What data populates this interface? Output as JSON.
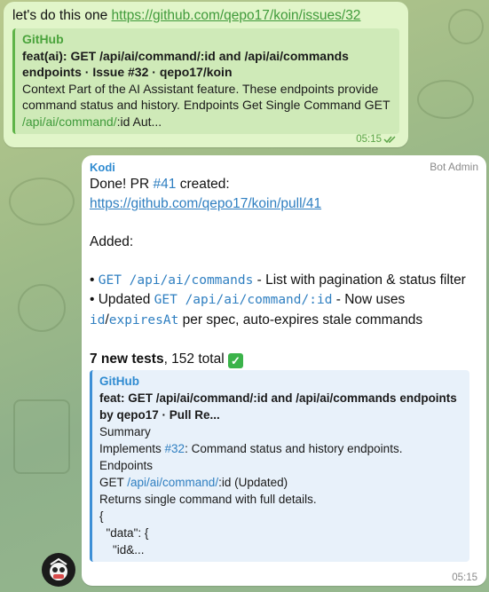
{
  "outgoing": {
    "text_prefix": "let's do this one ",
    "link": "https://github.com/qepo17/koin/issues/32",
    "preview": {
      "source": "GitHub",
      "title": "feat(ai): GET /api/ai/command/:id and /api/ai/commands endpoints · Issue #32 · qepo17/koin",
      "desc_a": "Context Part of the AI Assistant feature. These endpoints provide command status and history. Endpoints Get Single Command GET ",
      "desc_link": "/api/ai/command/",
      "desc_b": ":id Aut..."
    },
    "time": "05:15"
  },
  "incoming": {
    "sender": "Kodi",
    "role": "Bot Admin",
    "line1_a": "Done! PR ",
    "line1_pr": "#41",
    "line1_b": " created:",
    "pr_link": "https://github.com/qepo17/koin/pull/41",
    "added_label": "Added:",
    "bullet1": {
      "dot": "• ",
      "code": "GET /api/ai/commands",
      "rest": " - List with pagination & status filter"
    },
    "bullet2": {
      "prefix": "• Updated ",
      "code": "GET /api/ai/command/:id",
      "rest": " - Now uses ",
      "code2": "id",
      "slash": "/",
      "code3": "expiresAt",
      "rest2": " per spec, auto-expires stale commands"
    },
    "tests_bold": "7 new tests",
    "tests_rest": ", 152 total ",
    "check": "✓",
    "preview": {
      "source": "GitHub",
      "title": "feat: GET /api/ai/command/:id and /api/ai/commands endpoints by qepo17 · Pull Re...",
      "l1": "Summary",
      "l2_a": "Implements ",
      "l2_link": "#32",
      "l2_b": ": Command status and history endpoints.",
      "l3": "Endpoints",
      "l4_a": "GET ",
      "l4_link": "/api/ai/command/",
      "l4_b": ":id (Updated)",
      "l5": "Returns single command with full details.",
      "l6": "{",
      "l7": "  \"data\": {",
      "l8": "    \"id&..."
    },
    "time": "05:15"
  },
  "colors": {
    "outgoing_bg": "#e1f5c9",
    "incoming_bg": "#ffffff",
    "link_blue": "#2f7fc1",
    "link_green": "#3f9a3a"
  }
}
